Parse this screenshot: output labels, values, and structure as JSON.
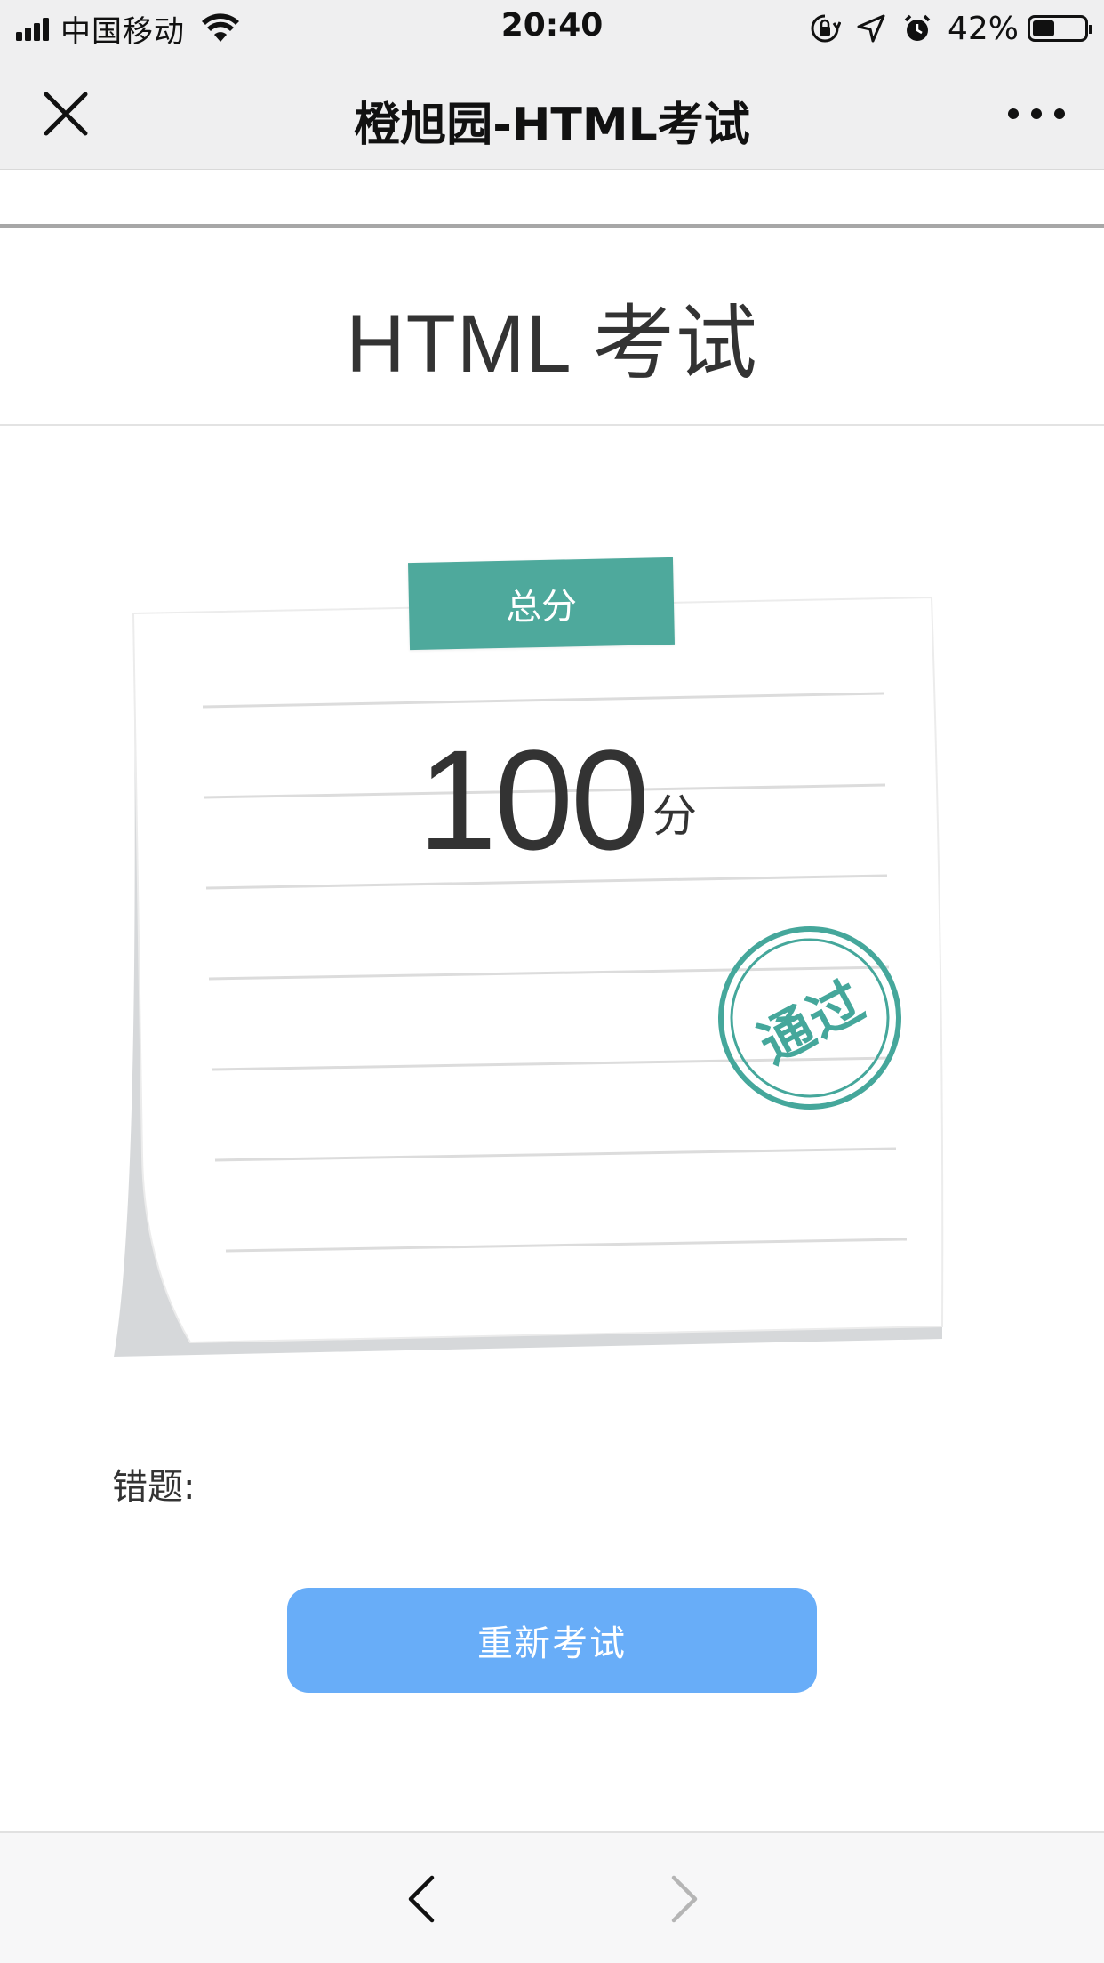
{
  "status_bar": {
    "carrier": "中国移动",
    "time": "20:40",
    "battery_percent": "42%",
    "battery_level": 0.42,
    "icons": [
      "signal-icon",
      "wifi-icon",
      "orientation-lock-icon",
      "location-arrow-icon",
      "alarm-icon",
      "battery-icon"
    ]
  },
  "navbar": {
    "title": "橙旭园-HTML考试",
    "left_icon": "close-icon",
    "right_icon": "more-icon"
  },
  "page": {
    "title": "HTML 考试"
  },
  "result": {
    "tag_label": "总分",
    "score": "100",
    "score_unit": "分",
    "stamp_text": "通过",
    "wrong_label": "错题:"
  },
  "actions": {
    "retake_label": "重新考试"
  },
  "bottom_toolbar": {
    "back_icon": "chevron-left-icon",
    "forward_icon": "chevron-right-icon",
    "forward_enabled": false
  },
  "colors": {
    "accent_green": "#4ea99c",
    "button_blue": "#68adf8",
    "bar_gray": "#efeff0"
  }
}
